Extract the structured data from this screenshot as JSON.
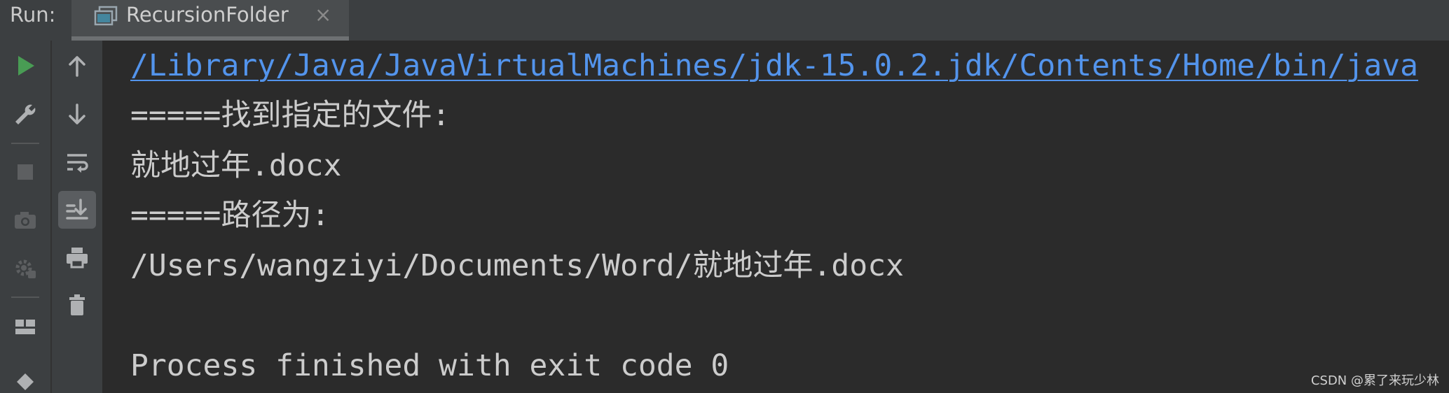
{
  "header": {
    "run_label": "Run:",
    "tab": {
      "title": "RecursionFolder",
      "close_glyph": "×",
      "icon": "run-config-icon"
    }
  },
  "toolbar_left": {
    "items": [
      {
        "name": "rerun",
        "icon": "play-icon",
        "color": "#499c54"
      },
      {
        "name": "settings",
        "icon": "wrench-icon"
      },
      {
        "name": "stop",
        "icon": "stop-icon",
        "enabled": false
      },
      {
        "name": "dump-threads",
        "icon": "camera-icon",
        "enabled": false
      },
      {
        "name": "debug-settings",
        "icon": "gear-bug-icon",
        "enabled": false
      },
      {
        "name": "layout",
        "icon": "layout-icon"
      },
      {
        "name": "pin",
        "icon": "pin-icon"
      }
    ]
  },
  "toolbar_right": {
    "items": [
      {
        "name": "up-stack",
        "icon": "arrow-up-icon"
      },
      {
        "name": "down-stack",
        "icon": "arrow-down-icon"
      },
      {
        "name": "soft-wrap",
        "icon": "soft-wrap-icon"
      },
      {
        "name": "scroll-to-end",
        "icon": "scroll-to-end-icon",
        "pressed": true
      },
      {
        "name": "print",
        "icon": "print-icon"
      },
      {
        "name": "clear-all",
        "icon": "trash-icon"
      }
    ]
  },
  "console": {
    "lines": [
      "/Library/Java/JavaVirtualMachines/jdk-15.0.2.jdk/Contents/Home/bin/java",
      "=====找到指定的文件:",
      "就地过年.docx",
      "=====路径为:",
      "/Users/wangziyi/Documents/Word/就地过年.docx",
      "",
      "Process finished with exit code 0"
    ],
    "colors": {
      "link": "#5394ec",
      "text": "#cccccc",
      "background": "#2b2b2b"
    }
  },
  "watermark": "CSDN @累了来玩少林"
}
